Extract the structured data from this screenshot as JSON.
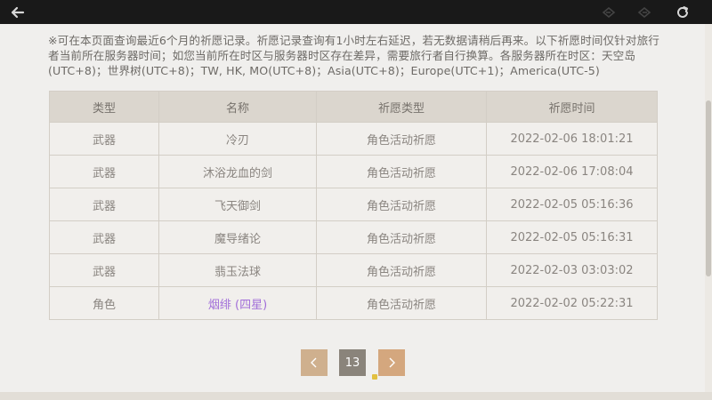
{
  "toolbar": {
    "back_icon": "back-arrow-icon",
    "nav_prev_icon": "diamond-left-icon",
    "nav_next_icon": "diamond-right-icon",
    "refresh_icon": "refresh-icon"
  },
  "notice": "※可在本页面查询最近6个月的祈愿记录。祈愿记录查询有1小时左右延迟，若无数据请稍后再来。以下祈愿时间仅针对旅行者当前所在服务器时间；如您当前所在时区与服务器时区存在差异，需要旅行者自行换算。各服务器所在时区：天空岛(UTC+8)；世界树(UTC+8)；TW, HK, MO(UTC+8)；Asia(UTC+8)；Europe(UTC+1)；America(UTC-5)",
  "table": {
    "headers": [
      "类型",
      "名称",
      "祈愿类型",
      "祈愿时间"
    ],
    "rows": [
      {
        "type": "武器",
        "name": "冷刃",
        "wish_type": "角色活动祈愿",
        "time": "2022-02-06 18:01:21"
      },
      {
        "type": "武器",
        "name": "沐浴龙血的剑",
        "wish_type": "角色活动祈愿",
        "time": "2022-02-06 17:08:04"
      },
      {
        "type": "武器",
        "name": "飞天御剑",
        "wish_type": "角色活动祈愿",
        "time": "2022-02-05 05:16:36"
      },
      {
        "type": "武器",
        "name": "魔导绪论",
        "wish_type": "角色活动祈愿",
        "time": "2022-02-05 05:16:31"
      },
      {
        "type": "武器",
        "name": "翡玉法球",
        "wish_type": "角色活动祈愿",
        "time": "2022-02-03 03:03:02"
      },
      {
        "type": "角色",
        "name": "烟绯 (四星)",
        "wish_type": "角色活动祈愿",
        "time": "2022-02-02 05:22:31",
        "highlight": "#a26fd9"
      }
    ]
  },
  "pagination": {
    "prev_icon": "chevron-left-icon",
    "current_page": "13",
    "next_icon": "chevron-right-icon"
  },
  "colors": {
    "accent_prev": "#cfb08e",
    "accent_next": "#d4a77e",
    "current_page_bg": "#8a847b",
    "four_star": "#a26fd9"
  }
}
